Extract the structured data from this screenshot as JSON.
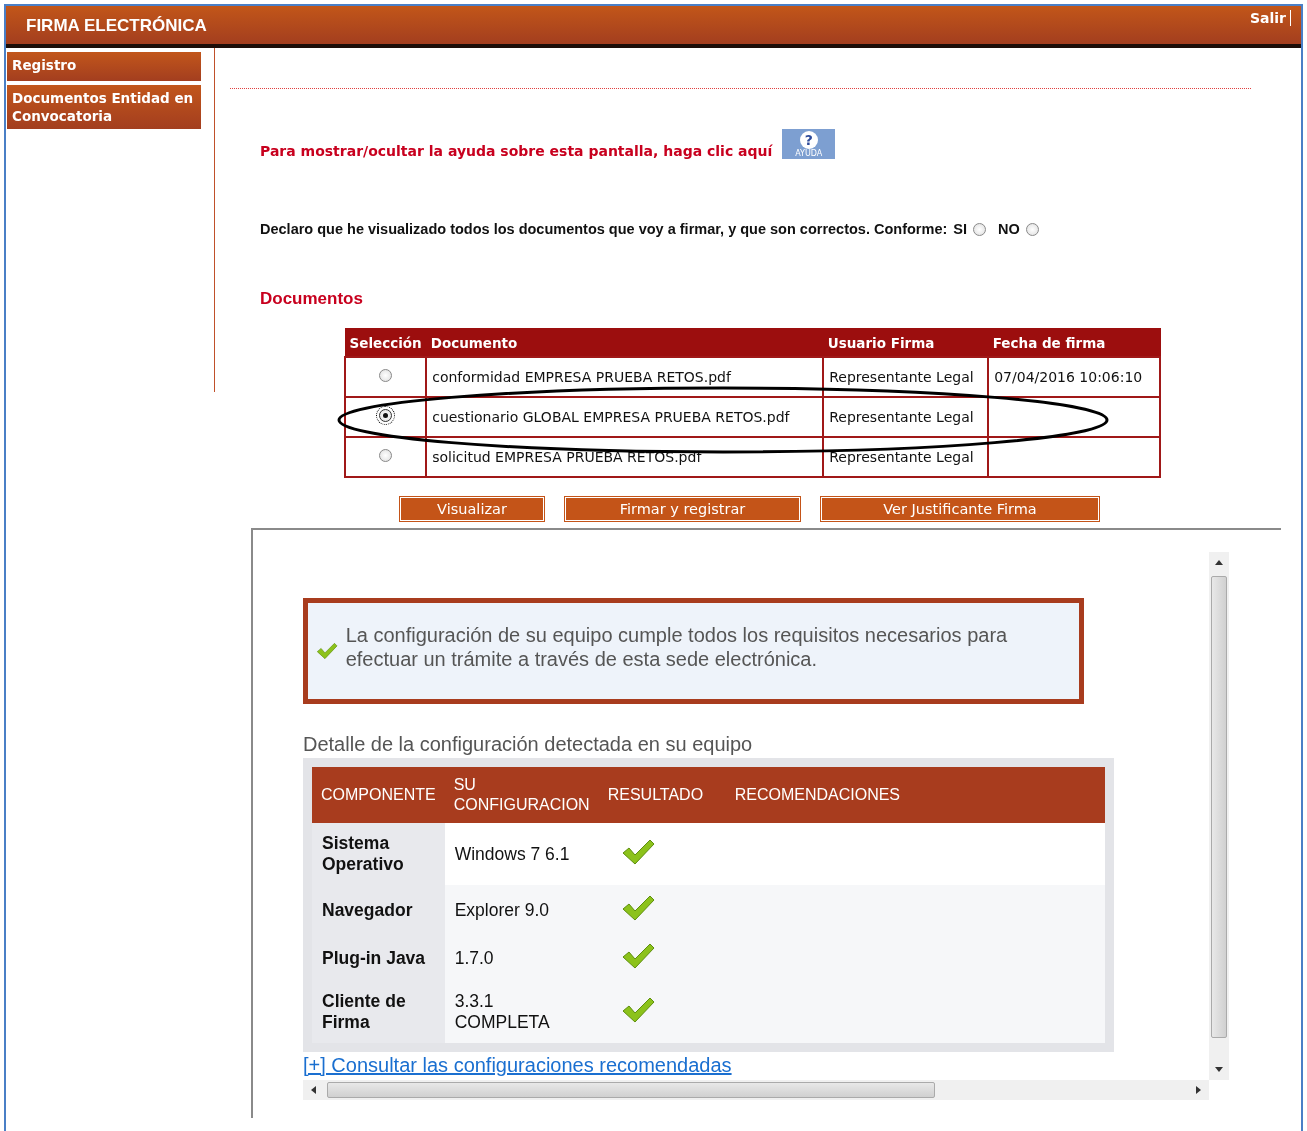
{
  "header": {
    "title": "FIRMA ELECTRÓNICA",
    "exit_link": "Salir"
  },
  "sidebar": {
    "items": [
      {
        "label": "Registro"
      },
      {
        "label": "Documentos Entidad en Convocatoria"
      }
    ]
  },
  "help": {
    "text": "Para mostrar/ocultar la ayuda sobre esta pantalla, haga clic aquí",
    "icon_glyph": "?",
    "icon_label": "AYUDA"
  },
  "declaration": {
    "text": "Declaro que he visualizado todos los documentos que voy a firmar, y que son correctos. Conforme:",
    "options": [
      {
        "label": "SI",
        "selected": false
      },
      {
        "label": "NO",
        "selected": false
      }
    ]
  },
  "documents": {
    "heading": "Documentos",
    "columns": [
      "Selección",
      "Documento",
      "Usuario Firma",
      "Fecha de firma"
    ],
    "rows": [
      {
        "selected": false,
        "circled": false,
        "document": "conformidad EMPRESA PRUEBA RETOS.pdf",
        "user": "Representante Legal",
        "date": "07/04/2016 10:06:10"
      },
      {
        "selected": true,
        "circled": true,
        "document": "cuestionario GLOBAL EMPRESA PRUEBA RETOS.pdf",
        "user": "Representante Legal"
      },
      {
        "selected": false,
        "circled": false,
        "document": "solicitud EMPRESA PRUEBA RETOS.pdf",
        "user": "Representante Legal"
      }
    ]
  },
  "buttons": [
    "Visualizar",
    "Firmar y registrar",
    "Ver Justificante Firma"
  ],
  "config": {
    "message": "La configuración de su equipo cumple todos los requisitos necesarios para efectuar un trámite a través de esta sede electrónica.",
    "message_ok": true,
    "detail_heading": "Detalle de la configuración detectada en su equipo",
    "columns": [
      "COMPONENTE",
      "SU\nCONFIGURACION",
      "RESULTADO",
      "RECOMENDACIONES"
    ],
    "rows": [
      {
        "component": "Sistema\nOperativo",
        "configuration": "Windows 7 6.1",
        "result_ok": true
      },
      {
        "component": "Navegador",
        "configuration": "Explorer 9.0",
        "result_ok": true
      },
      {
        "component": "Plug-in Java",
        "configuration": "1.7.0",
        "result_ok": true
      },
      {
        "component": "Cliente de\nFirma",
        "configuration": "3.3.1\nCOMPLETA",
        "result_ok": true
      }
    ],
    "link": "[+] Consultar las configuraciones recomendadas"
  }
}
